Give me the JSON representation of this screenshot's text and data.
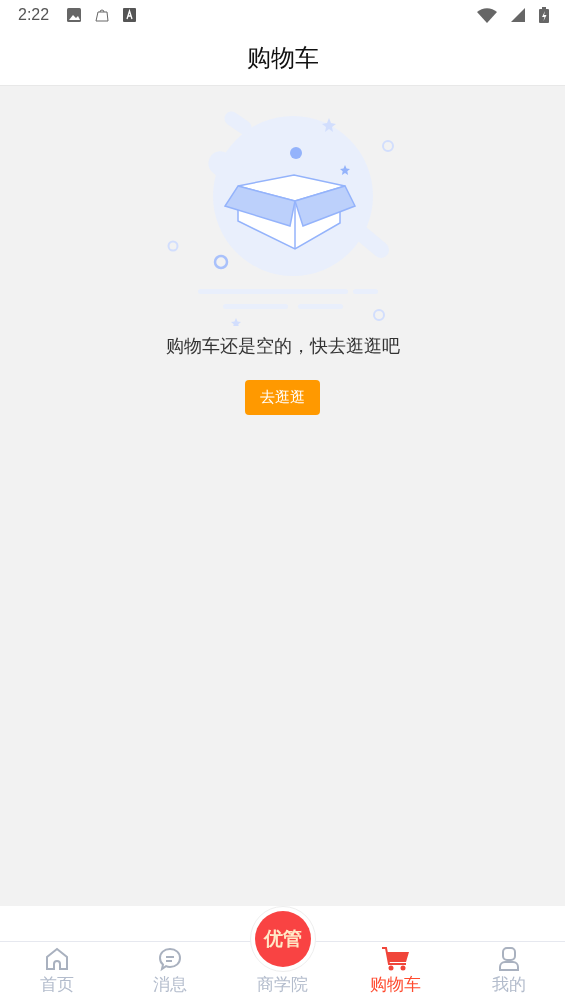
{
  "status_bar": {
    "time": "2:22"
  },
  "header": {
    "title": "购物车"
  },
  "empty_state": {
    "message": "购物车还是空的，快去逛逛吧",
    "button": "去逛逛"
  },
  "tabs": [
    {
      "label": "首页",
      "selected": false
    },
    {
      "label": "消息",
      "selected": false
    },
    {
      "label": "商学院",
      "selected": false,
      "badge": "优管"
    },
    {
      "label": "购物车",
      "selected": true
    },
    {
      "label": "我的",
      "selected": false
    }
  ]
}
